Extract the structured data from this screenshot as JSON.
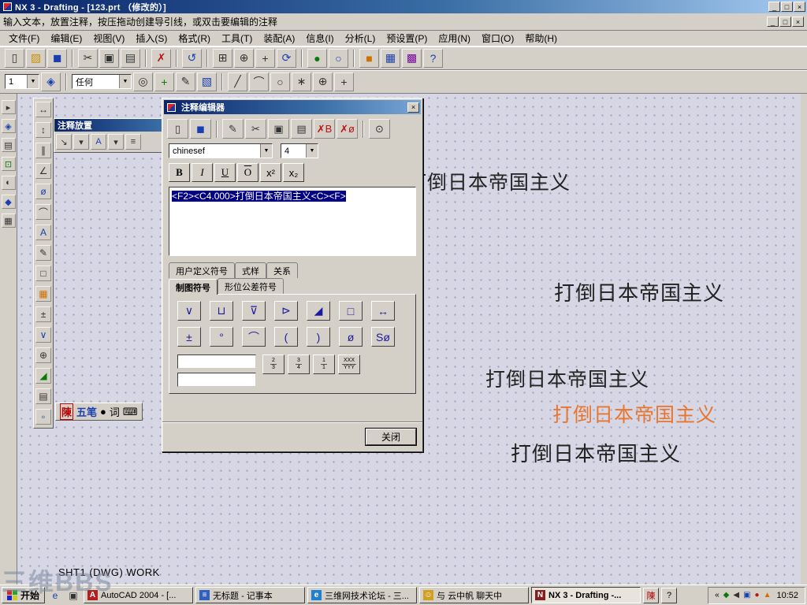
{
  "ui": {
    "minimize": "_",
    "maximize": "□",
    "close": "×",
    "dropdown_arrow": "▼"
  },
  "titlebar": {
    "title": "NX 3 - Drafting - [123.prt （修改的）]"
  },
  "promptbar": {
    "text": "输入文本，放置注释，按压拖动创建导引线，或双击要编辑的注释"
  },
  "menubar": {
    "items": [
      "文件(F)",
      "编辑(E)",
      "视图(V)",
      "插入(S)",
      "格式(R)",
      "工具(T)",
      "装配(A)",
      "信息(I)",
      "分析(L)",
      "预设置(P)",
      "应用(N)",
      "窗口(O)",
      "帮助(H)"
    ]
  },
  "toolbar1": {
    "icons": [
      {
        "name": "new-file-icon",
        "glyph": "▯"
      },
      {
        "name": "open-file-icon",
        "glyph": "▨"
      },
      {
        "name": "save-icon",
        "glyph": "◼"
      },
      {
        "name": "cut-icon",
        "glyph": "✂"
      },
      {
        "name": "copy-icon",
        "glyph": "▣"
      },
      {
        "name": "paste-icon",
        "glyph": "▤"
      },
      {
        "name": "delete-icon",
        "glyph": "✗"
      },
      {
        "name": "undo-icon",
        "glyph": "↺"
      },
      {
        "name": "zoom-fit-icon",
        "glyph": "⊞"
      },
      {
        "name": "zoom-in-icon",
        "glyph": "⊕"
      },
      {
        "name": "pan-icon",
        "glyph": "+"
      },
      {
        "name": "rotate-view-icon",
        "glyph": "⟳"
      },
      {
        "name": "shaded-view-icon",
        "glyph": "●"
      },
      {
        "name": "wireframe-view-icon",
        "glyph": "○"
      },
      {
        "name": "app-modeling-icon",
        "glyph": "■"
      },
      {
        "name": "app-drafting-icon",
        "glyph": "▦"
      },
      {
        "name": "app-assembly-icon",
        "glyph": "▩"
      },
      {
        "name": "help-icon",
        "glyph": "?"
      }
    ]
  },
  "toolbar2": {
    "layer_value": "1",
    "filter_value": "任何",
    "icons_a": [
      {
        "name": "layer-settings-icon",
        "glyph": "◈"
      }
    ],
    "icons_b": [
      {
        "name": "snap-point-icon",
        "glyph": "◎"
      },
      {
        "name": "create-point-icon",
        "glyph": "+"
      },
      {
        "name": "edit-object-icon",
        "glyph": "✎"
      },
      {
        "name": "display-settings-icon",
        "glyph": "▧"
      }
    ],
    "icons_c": [
      {
        "name": "line-icon",
        "glyph": "╱"
      },
      {
        "name": "arc-icon",
        "glyph": "⌒"
      },
      {
        "name": "circle-icon",
        "glyph": "○"
      },
      {
        "name": "point-icon",
        "glyph": "∗"
      },
      {
        "name": "target-icon",
        "glyph": "⊕"
      },
      {
        "name": "plus-icon",
        "glyph": "+"
      }
    ]
  },
  "left_dock": {
    "icons": [
      {
        "name": "select-icon",
        "glyph": "▸"
      },
      {
        "name": "snap-icon",
        "glyph": "◈"
      },
      {
        "name": "layers-icon",
        "glyph": "▤"
      },
      {
        "name": "fit-view-icon",
        "glyph": "⊡"
      },
      {
        "name": "display-icon",
        "glyph": "◐"
      },
      {
        "name": "star-tool-icon",
        "glyph": "◆"
      },
      {
        "name": "grid-icon",
        "glyph": "▦"
      }
    ]
  },
  "drafting_toolbar": {
    "icons": [
      {
        "name": "horizontal-dimension-icon",
        "glyph": "↔"
      },
      {
        "name": "vertical-dimension-icon",
        "glyph": "↕"
      },
      {
        "name": "parallel-dimension-icon",
        "glyph": "∥"
      },
      {
        "name": "angular-dimension-icon",
        "glyph": "∠"
      },
      {
        "name": "diameter-dimension-icon",
        "glyph": "ø"
      },
      {
        "name": "radius-dimension-icon",
        "glyph": "⌒"
      },
      {
        "name": "text-note-icon",
        "glyph": "A"
      },
      {
        "name": "label-icon",
        "glyph": "✎"
      },
      {
        "name": "rectangle-icon",
        "glyph": "□"
      },
      {
        "name": "table-icon",
        "glyph": "▦"
      },
      {
        "name": "tolerance-icon",
        "glyph": "±"
      },
      {
        "name": "surface-finish-icon",
        "glyph": "∨"
      },
      {
        "name": "center-mark-icon",
        "glyph": "⊕"
      },
      {
        "name": "slope-symbol-icon",
        "glyph": "◢"
      },
      {
        "name": "sheet-icon",
        "glyph": "▤"
      },
      {
        "name": "view-creation-icon",
        "glyph": "▫"
      }
    ]
  },
  "annotation_panel": {
    "title": "注释放置",
    "icons": [
      {
        "name": "leader-icon",
        "glyph": "↘"
      },
      {
        "name": "leader-options-icon",
        "glyph": "▾"
      },
      {
        "name": "text-style-icon",
        "glyph": "A"
      },
      {
        "name": "style-options-icon",
        "glyph": "▾"
      },
      {
        "name": "placement-options-icon",
        "glyph": "≡"
      }
    ]
  },
  "ime_bar": {
    "name_key": "陳",
    "mode": "五笔",
    "dot": "●",
    "word": "词",
    "keyboard": "⌨"
  },
  "dialog": {
    "title": "注释编辑器",
    "toolbar_icons": [
      {
        "name": "new-text-icon",
        "glyph": "▯"
      },
      {
        "name": "save-text-icon",
        "glyph": "◼"
      },
      {
        "name": "edit-text-icon",
        "glyph": "✎"
      },
      {
        "name": "cut-icon",
        "glyph": "✂"
      },
      {
        "name": "copy-icon",
        "glyph": "▣"
      },
      {
        "name": "paste-icon",
        "glyph": "▤"
      },
      {
        "name": "delete-attributes-icon",
        "glyph": "✗B"
      },
      {
        "name": "clear-symbols-icon",
        "glyph": "✗ø"
      },
      {
        "name": "preview-icon",
        "glyph": "⊙"
      }
    ],
    "font": "chinesef",
    "size": "4",
    "format_buttons": [
      "B",
      "I",
      "U",
      "O",
      "x²",
      "x₂"
    ],
    "text": "<F2><C4.000>打倒日本帝国主义<C><F>",
    "tabs_top": [
      "用户定义符号",
      "式样",
      "关系"
    ],
    "tabs_bottom": [
      "制图符号",
      "形位公差符号"
    ],
    "symbols_row1": [
      "∨",
      "⊔",
      "⊽",
      "⊳",
      "◢",
      "□",
      "↔"
    ],
    "symbols_row2": [
      "±",
      "°",
      "⌒",
      "(",
      ")",
      "ø",
      "Sø"
    ],
    "fraction_buttons": [
      [
        "2",
        "3"
      ],
      [
        "3",
        "4"
      ],
      [
        "1",
        "1"
      ],
      [
        "XXX",
        "YYY"
      ]
    ],
    "close_label": "关闭"
  },
  "canvas": {
    "annotations": [
      {
        "text": "打倒日本帝国主义",
        "color": "#222222"
      },
      {
        "text": "打倒日本帝国主义",
        "color": "#222222"
      },
      {
        "text": "打倒日本帝国主义",
        "color": "#222222"
      },
      {
        "text": "打倒日本帝国主义",
        "color": "#e8762e"
      },
      {
        "text": "打倒日本帝国主义",
        "color": "#222222"
      }
    ]
  },
  "status_line": {
    "text": "SHT1 (DWG) WORK"
  },
  "watermark": {
    "text": "三维BBS"
  },
  "taskbar": {
    "start_label": "开始",
    "quick_launch": [
      {
        "name": "internet-explorer-icon",
        "glyph": "e"
      },
      {
        "name": "show-desktop-icon",
        "glyph": "▣"
      }
    ],
    "tasks": [
      {
        "glyph": "A",
        "label": "AutoCAD 2004 - [..."
      },
      {
        "glyph": "≡",
        "label": "无标题 - 记事本"
      },
      {
        "glyph": "e",
        "label": "三维网技术论坛 - 三..."
      },
      {
        "glyph": "☺",
        "label": "与 云中帆 聊天中"
      },
      {
        "glyph": "N",
        "label": "NX 3 - Drafting -..."
      }
    ],
    "ime_button_label": "陳",
    "help_button_label": "?",
    "tray_chevron": "«",
    "tray_icons": [
      {
        "name": "messenger-icon",
        "glyph": "◆"
      },
      {
        "name": "volume-icon",
        "glyph": "◀"
      },
      {
        "name": "network-icon",
        "glyph": "▣"
      },
      {
        "name": "antivirus-icon",
        "glyph": "●"
      },
      {
        "name": "ime-indicator-icon",
        "glyph": "▲"
      }
    ],
    "clock": "10:52"
  }
}
